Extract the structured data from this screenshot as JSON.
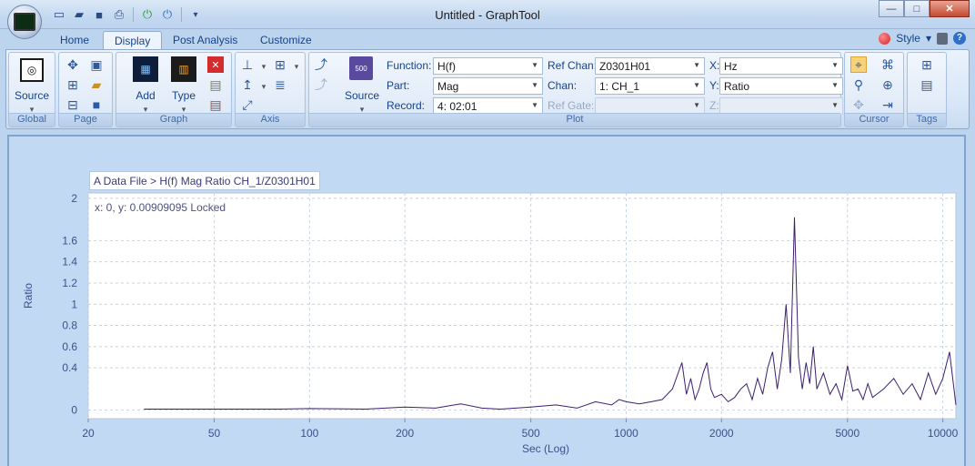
{
  "window": {
    "title": "Untitled - GraphTool",
    "min_symbol": "—",
    "max_symbol": "□",
    "close_symbol": "✕"
  },
  "tabs": [
    {
      "label": "Home"
    },
    {
      "label": "Display"
    },
    {
      "label": "Post Analysis"
    },
    {
      "label": "Customize"
    }
  ],
  "style_menu": {
    "label": "Style",
    "arrow": "▾"
  },
  "groups": {
    "global": {
      "label": "Global",
      "source_label": "Source"
    },
    "page": {
      "label": "Page"
    },
    "graph": {
      "label": "Graph",
      "add_label": "Add",
      "type_label": "Type"
    },
    "axis": {
      "label": "Axis"
    },
    "plot": {
      "label": "Plot",
      "source_label": "Source",
      "source_badge": "500",
      "function_label": "Function:",
      "function_value": "H(f)",
      "part_label": "Part:",
      "part_value": "Mag",
      "record_label": "Record:",
      "record_value": "4: 02:01",
      "ref_chan_label": "Ref Chan:",
      "ref_chan_value": "Z0301H01",
      "chan_label": "Chan:",
      "chan_value": "1: CH_1",
      "ref_gate_label": "Ref Gate:",
      "ref_gate_value": "",
      "x_label": "X:",
      "x_value": "Hz",
      "y_label": "Y:",
      "y_value": "Ratio",
      "z_label": "Z:",
      "z_value": ""
    },
    "cursor": {
      "label": "Cursor"
    },
    "tags": {
      "label": "Tags"
    }
  },
  "graph_view": {
    "title": "A Data File > H(f) Mag Ratio CH_1/Z0301H01",
    "cursor_readout": "x: 0, y: 0.00909095 Locked"
  },
  "chart_data": {
    "type": "line",
    "title": "A Data File > H(f) Mag Ratio CH_1/Z0301H01",
    "xlabel": "Sec (Log)",
    "ylabel": "Ratio",
    "x_scale": "log",
    "xlim": [
      20,
      11000
    ],
    "ylim": [
      -0.08,
      2.05
    ],
    "x_ticks": [
      20,
      50,
      100,
      200,
      500,
      1000,
      2000,
      5000,
      10000
    ],
    "y_ticks": [
      0,
      0.4,
      0.6,
      0.8,
      1,
      1.2,
      1.4,
      1.6,
      2
    ],
    "grid": true,
    "line_color": "#3b1f6e",
    "series": [
      {
        "x": [
          30,
          50,
          80,
          100,
          150,
          200,
          250,
          300,
          350,
          400,
          500,
          600,
          700,
          800,
          900,
          950,
          1000,
          1100,
          1200,
          1300,
          1400,
          1500,
          1550,
          1600,
          1650,
          1700,
          1750,
          1800,
          1850,
          1900,
          2000,
          2100,
          2200,
          2300,
          2400,
          2500,
          2600,
          2700,
          2800,
          2900,
          3000,
          3100,
          3200,
          3300,
          3400,
          3500,
          3600,
          3700,
          3800,
          3900,
          4000,
          4200,
          4400,
          4600,
          4800,
          5000,
          5200,
          5400,
          5600,
          5800,
          6000,
          6500,
          7000,
          7500,
          8000,
          8500,
          9000,
          9500,
          10000,
          10500,
          11000
        ],
        "y": [
          0.01,
          0.01,
          0.01,
          0.015,
          0.01,
          0.03,
          0.02,
          0.06,
          0.02,
          0.01,
          0.03,
          0.05,
          0.02,
          0.08,
          0.05,
          0.1,
          0.08,
          0.06,
          0.08,
          0.1,
          0.2,
          0.45,
          0.15,
          0.3,
          0.1,
          0.2,
          0.35,
          0.45,
          0.2,
          0.12,
          0.15,
          0.08,
          0.12,
          0.2,
          0.25,
          0.1,
          0.3,
          0.15,
          0.4,
          0.55,
          0.2,
          0.48,
          1.0,
          0.35,
          1.82,
          0.5,
          0.2,
          0.45,
          0.25,
          0.6,
          0.2,
          0.35,
          0.15,
          0.25,
          0.1,
          0.42,
          0.18,
          0.2,
          0.1,
          0.25,
          0.12,
          0.2,
          0.3,
          0.15,
          0.25,
          0.1,
          0.35,
          0.15,
          0.3,
          0.55,
          0.05
        ]
      }
    ]
  }
}
